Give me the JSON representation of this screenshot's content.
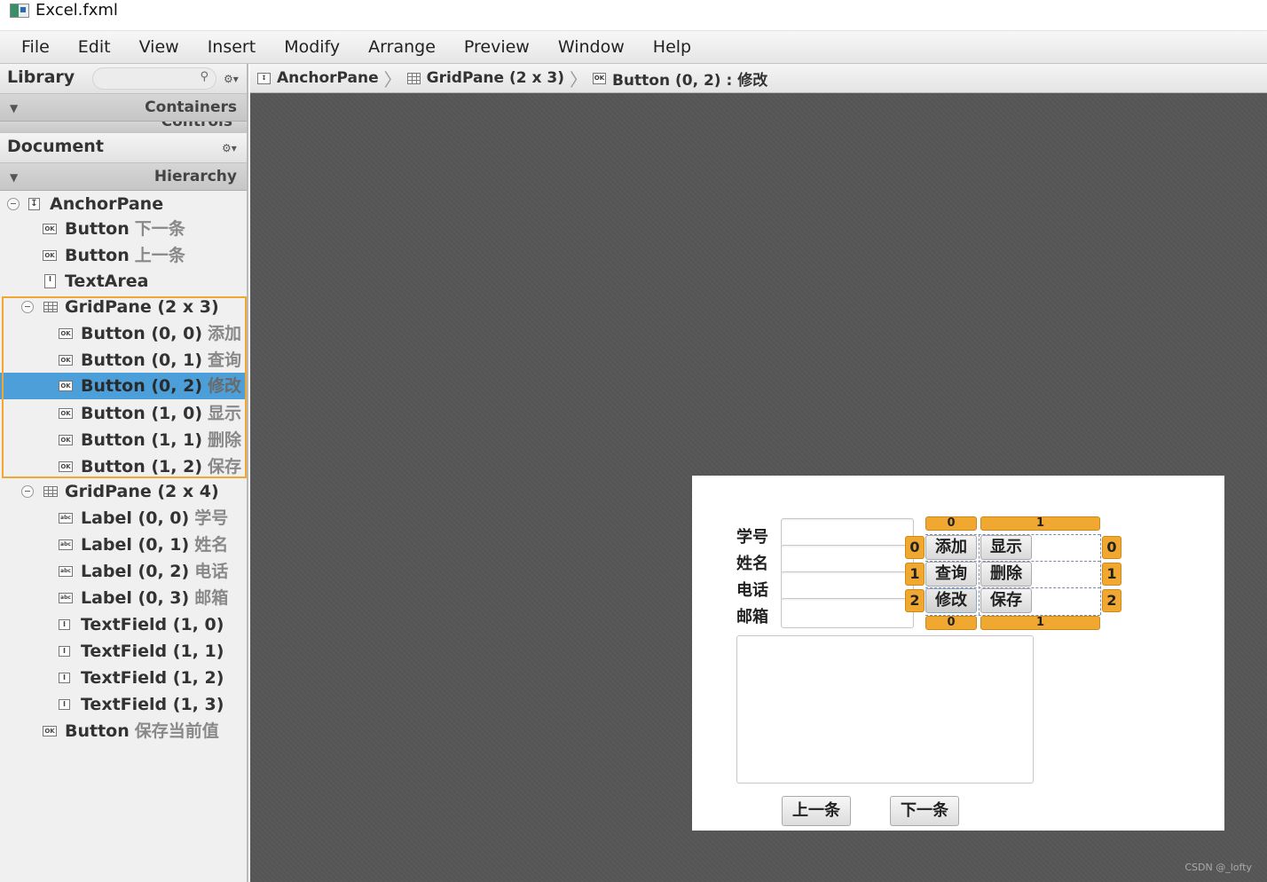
{
  "window": {
    "title": "Excel.fxml"
  },
  "menu": [
    "File",
    "Edit",
    "View",
    "Insert",
    "Modify",
    "Arrange",
    "Preview",
    "Window",
    "Help"
  ],
  "library": {
    "title": "Library",
    "search_placeholder": "",
    "section": "Containers",
    "section_next": "Controls"
  },
  "document": {
    "title": "Document",
    "section": "Hierarchy"
  },
  "hierarchy": [
    {
      "type": "AnchorPane",
      "text": ""
    },
    {
      "type": "Button",
      "text": "下一条"
    },
    {
      "type": "Button",
      "text": "上一条"
    },
    {
      "type": "TextArea",
      "text": ""
    },
    {
      "type": "GridPane (2 x 3)",
      "text": ""
    },
    {
      "type": "Button (0, 0)",
      "text": "添加"
    },
    {
      "type": "Button (0, 1)",
      "text": "查询"
    },
    {
      "type": "Button (0, 2)",
      "text": "修改"
    },
    {
      "type": "Button (1, 0)",
      "text": "显示"
    },
    {
      "type": "Button (1, 1)",
      "text": "删除"
    },
    {
      "type": "Button (1, 2)",
      "text": "保存"
    },
    {
      "type": "GridPane (2 x 4)",
      "text": ""
    },
    {
      "type": "Label (0, 0)",
      "text": "学号"
    },
    {
      "type": "Label (0, 1)",
      "text": "姓名"
    },
    {
      "type": "Label (0, 2)",
      "text": "电话"
    },
    {
      "type": "Label (0, 3)",
      "text": "邮箱"
    },
    {
      "type": "TextField (1, 0)",
      "text": ""
    },
    {
      "type": "TextField (1, 1)",
      "text": ""
    },
    {
      "type": "TextField (1, 2)",
      "text": ""
    },
    {
      "type": "TextField (1, 3)",
      "text": ""
    },
    {
      "type": "Button",
      "text": "保存当前值"
    }
  ],
  "breadcrumb": [
    "AnchorPane",
    "GridPane (2 x 3)",
    "Button (0, 2) : 修改"
  ],
  "form": {
    "labels": [
      "学号",
      "姓名",
      "电话",
      "邮箱"
    ],
    "grid_buttons": [
      "添加",
      "显示",
      "查询",
      "删除",
      "修改",
      "保存"
    ],
    "col_headers": [
      "0",
      "1"
    ],
    "row_headers": [
      "0",
      "1",
      "2"
    ],
    "prev_button": "上一条",
    "next_button": "下一条"
  },
  "watermark": "CSDN @_lofty",
  "colors": {
    "selection": "#4c9fd8",
    "grid_handle": "#f0a830",
    "canvas": "#555555"
  }
}
